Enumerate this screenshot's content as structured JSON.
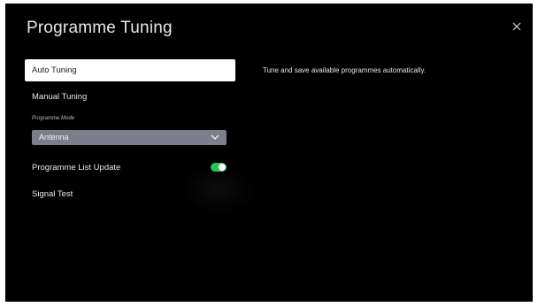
{
  "page": {
    "title": "Programme Tuning"
  },
  "icons": {
    "close": "close-icon",
    "dropdown": "chevron-down-icon"
  },
  "menu": {
    "auto_tuning": "Auto Tuning",
    "manual_tuning": "Manual Tuning",
    "programme_mode_label": "Programme Mode",
    "programme_mode_value": "Antenna",
    "programme_list_update": "Programme List Update",
    "programme_list_update_on": true,
    "signal_test": "Signal Test"
  },
  "detail": {
    "description": "Tune and save available programmes automatically."
  },
  "colors": {
    "background": "#000000",
    "selected_item": "#ffffff",
    "dropdown": "#7a7f8c",
    "toggle_on": "#22c55e"
  }
}
